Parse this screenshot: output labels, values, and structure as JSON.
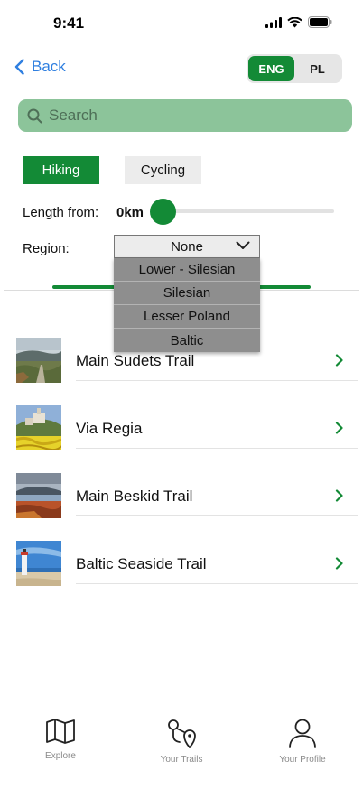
{
  "status_bar": {
    "time": "9:41"
  },
  "nav": {
    "back_label": "Back"
  },
  "language": {
    "options": [
      "ENG",
      "PL"
    ],
    "selected": "ENG"
  },
  "search": {
    "placeholder": "Search"
  },
  "activity_filters": {
    "options": [
      "Hiking",
      "Cycling"
    ],
    "selected": "Hiking"
  },
  "length_filter": {
    "label": "Length from:",
    "value": "0km"
  },
  "region_filter": {
    "label": "Region:",
    "selected": "None",
    "options": [
      "Lower - Silesian",
      "Silesian",
      "Lesser Poland",
      "Baltic"
    ]
  },
  "trails": [
    {
      "name": "Main Sudets Trail",
      "thumb_icon": "mountain-path-photo"
    },
    {
      "name": "Via Regia",
      "thumb_icon": "castle-hill-photo"
    },
    {
      "name": "Main Beskid Trail",
      "thumb_icon": "mountain-lake-photo"
    },
    {
      "name": "Baltic Seaside Trail",
      "thumb_icon": "lighthouse-beach-photo"
    }
  ],
  "tab_bar": [
    {
      "label": "Explore",
      "icon": "map-icon"
    },
    {
      "label": "Your Trails",
      "icon": "route-icon"
    },
    {
      "label": "Your Profile",
      "icon": "person-icon"
    }
  ],
  "colors": {
    "accent": "#138a36",
    "search_bg": "#8cc49a",
    "link": "#2f7fe0"
  }
}
